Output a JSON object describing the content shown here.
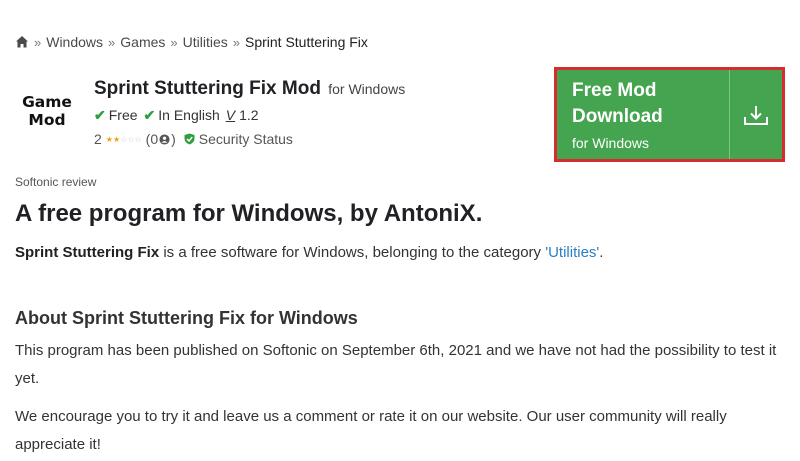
{
  "breadcrumb": {
    "home_icon": "home-icon",
    "separator": "»",
    "items": [
      "Windows",
      "Games",
      "Utilities"
    ],
    "current": "Sprint Stuttering Fix"
  },
  "app": {
    "logo_text": [
      "Game",
      "Mod"
    ],
    "title": "Sprint Stuttering Fix Mod",
    "for_os": "for Windows",
    "license": "Free",
    "language": "In English",
    "version_icon": "V",
    "version": "1.2",
    "rating_value": "2",
    "stars_filled": 2,
    "stars_total": 5,
    "reviews_count": "(0",
    "reviews_close": ")",
    "security": "Security Status"
  },
  "download": {
    "label": "Free Mod Download",
    "sub_label": "for Windows",
    "icon": "download-icon",
    "accent": "#44a44f",
    "highlight": "#d62c2c"
  },
  "review": {
    "tag": "Softonic review",
    "headline": "A free program for Windows, by AntoniX.",
    "intro_bold": "Sprint Stuttering Fix",
    "intro_text": " is a free software for Windows, belonging to the category ",
    "category_link": "'Utilities'",
    "intro_end": ".",
    "section_title": "About Sprint Stuttering Fix for Windows",
    "para1": "This program has been published on Softonic on September 6th, 2021 and we have not had the possibility to test it yet.",
    "para2": "We encourage you to try it and leave us a comment or rate it on our website. Our user community will really appreciate it!"
  }
}
